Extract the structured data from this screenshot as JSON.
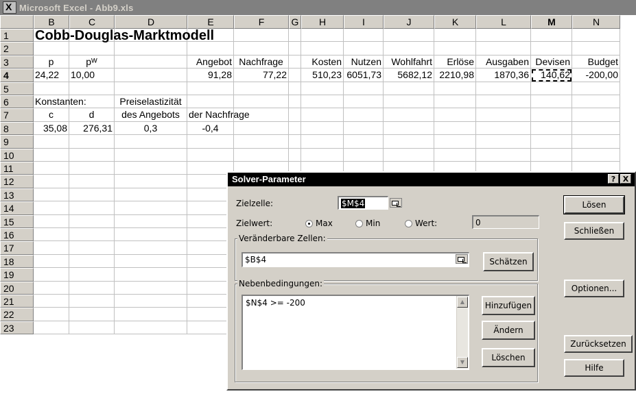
{
  "window": {
    "title": "Microsoft Excel - Abb9.xls"
  },
  "sheet": {
    "columns": [
      "B",
      "C",
      "D",
      "E",
      "F",
      "G",
      "H",
      "I",
      "J",
      "K",
      "L",
      "M",
      "N"
    ],
    "active_column": "M",
    "rows": [
      "1",
      "2",
      "3",
      "4",
      "5",
      "6",
      "7",
      "8",
      "9",
      "10",
      "11",
      "12",
      "13",
      "14",
      "15",
      "16",
      "17",
      "18",
      "19",
      "20",
      "21",
      "22",
      "23"
    ],
    "active_row": "4",
    "cells": {
      "B1": "Cobb-Douglas-Marktmodell",
      "B3": "p",
      "C3": "pᵂ",
      "E3": "Angebot",
      "F3": "Nachfrage",
      "H3": "Kosten",
      "I3": "Nutzen",
      "J3": "Wohlfahrt",
      "K3": "Erlöse",
      "L3": "Ausgaben",
      "M3": "Devisen",
      "N3": "Budget",
      "B4": "24,22",
      "C4": "10,00",
      "E4": "91,28",
      "F4": "77,22",
      "H4": "510,23",
      "I4": "6051,73",
      "J4": "5682,12",
      "K4": "2210,98",
      "L4": "1870,36",
      "M4": "140,62",
      "N4": "-200,00",
      "B6": "Konstanten:",
      "D6": "Preiselastizität",
      "B7": "c",
      "C7": "d",
      "D7": "des Angebots",
      "E7": "der Nachfrage",
      "B8": "35,08",
      "C8": "276,31",
      "D8": "0,3",
      "E8": "-0,4"
    }
  },
  "dialog": {
    "title": "Solver-Parameter",
    "help_btn": "?",
    "close_btn": "X",
    "target_cell_label": "Zielzelle:",
    "target_cell_value": "$M$4",
    "target_value_label": "Zielwert:",
    "opt_max": "Max",
    "opt_min": "Min",
    "opt_value": "Wert:",
    "value_field": "0",
    "changing_cells_label": "Veränderbare Zellen:",
    "changing_cells_value": "$B$4",
    "guess_btn": "Schätzen",
    "constraints_label": "Nebenbedingungen:",
    "constraints": [
      "$N$4 >= -200"
    ],
    "add_btn": "Hinzufügen",
    "change_btn": "Ändern",
    "delete_btn": "Löschen",
    "solve_btn": "Lösen",
    "close_dialog_btn": "Schließen",
    "options_btn": "Optionen...",
    "reset_btn": "Zurücksetzen",
    "help_button": "Hilfe"
  }
}
